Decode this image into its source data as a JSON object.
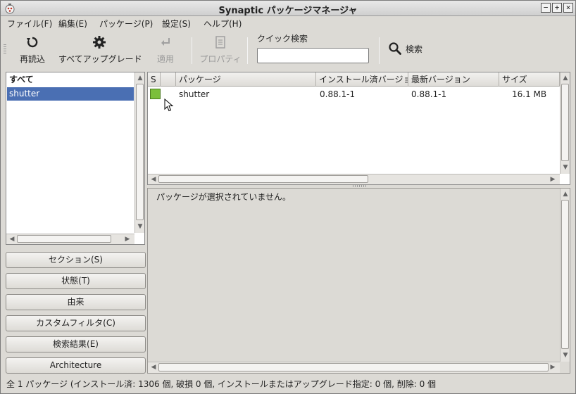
{
  "window": {
    "title": "Synaptic パッケージマネージャ",
    "controls": {
      "minimize": "−",
      "maximize": "+",
      "close": "×"
    }
  },
  "menu": [
    {
      "label": "ファイル(F)"
    },
    {
      "label": "編集(E)"
    },
    {
      "label": "パッケージ(P)"
    },
    {
      "label": "設定(S)"
    },
    {
      "label": "ヘルプ(H)"
    }
  ],
  "toolbar": {
    "reload_label": "再読込",
    "upgrade_all_label": "すべてアップグレード",
    "apply_label": "適用",
    "properties_label": "プロパティ",
    "quick_search_label": "クイック検索",
    "quick_search_value": "",
    "search_label": "検索"
  },
  "filter_list": {
    "items": [
      {
        "label": "すべて"
      },
      {
        "label": "shutter",
        "selected": true
      }
    ]
  },
  "filter_buttons": [
    {
      "label": "セクション(S)"
    },
    {
      "label": "状態(T)"
    },
    {
      "label": "由来"
    },
    {
      "label": "カスタムフィルタ(C)"
    },
    {
      "label": "検索結果(E)"
    },
    {
      "label": "Architecture"
    }
  ],
  "package_table": {
    "columns": [
      "S",
      "パッケージ",
      "インストール済バージョン",
      "最新バージョン",
      "サイズ"
    ],
    "rows": [
      {
        "status": "installed",
        "name": "shutter",
        "installed_version": "0.88.1-1",
        "latest_version": "0.88.1-1",
        "size": "16.1 MB"
      }
    ]
  },
  "details": {
    "message": "パッケージが選択されていません。"
  },
  "statusbar": {
    "text": "全 1 パッケージ (インストール済: 1306 個, 破損 0 個, インストールまたはアップグレード指定: 0 個, 削除: 0 個"
  },
  "colors": {
    "selection": "#4a6fb3",
    "installed_status": "#7bbf3a",
    "window_bg": "#dcdad5"
  }
}
